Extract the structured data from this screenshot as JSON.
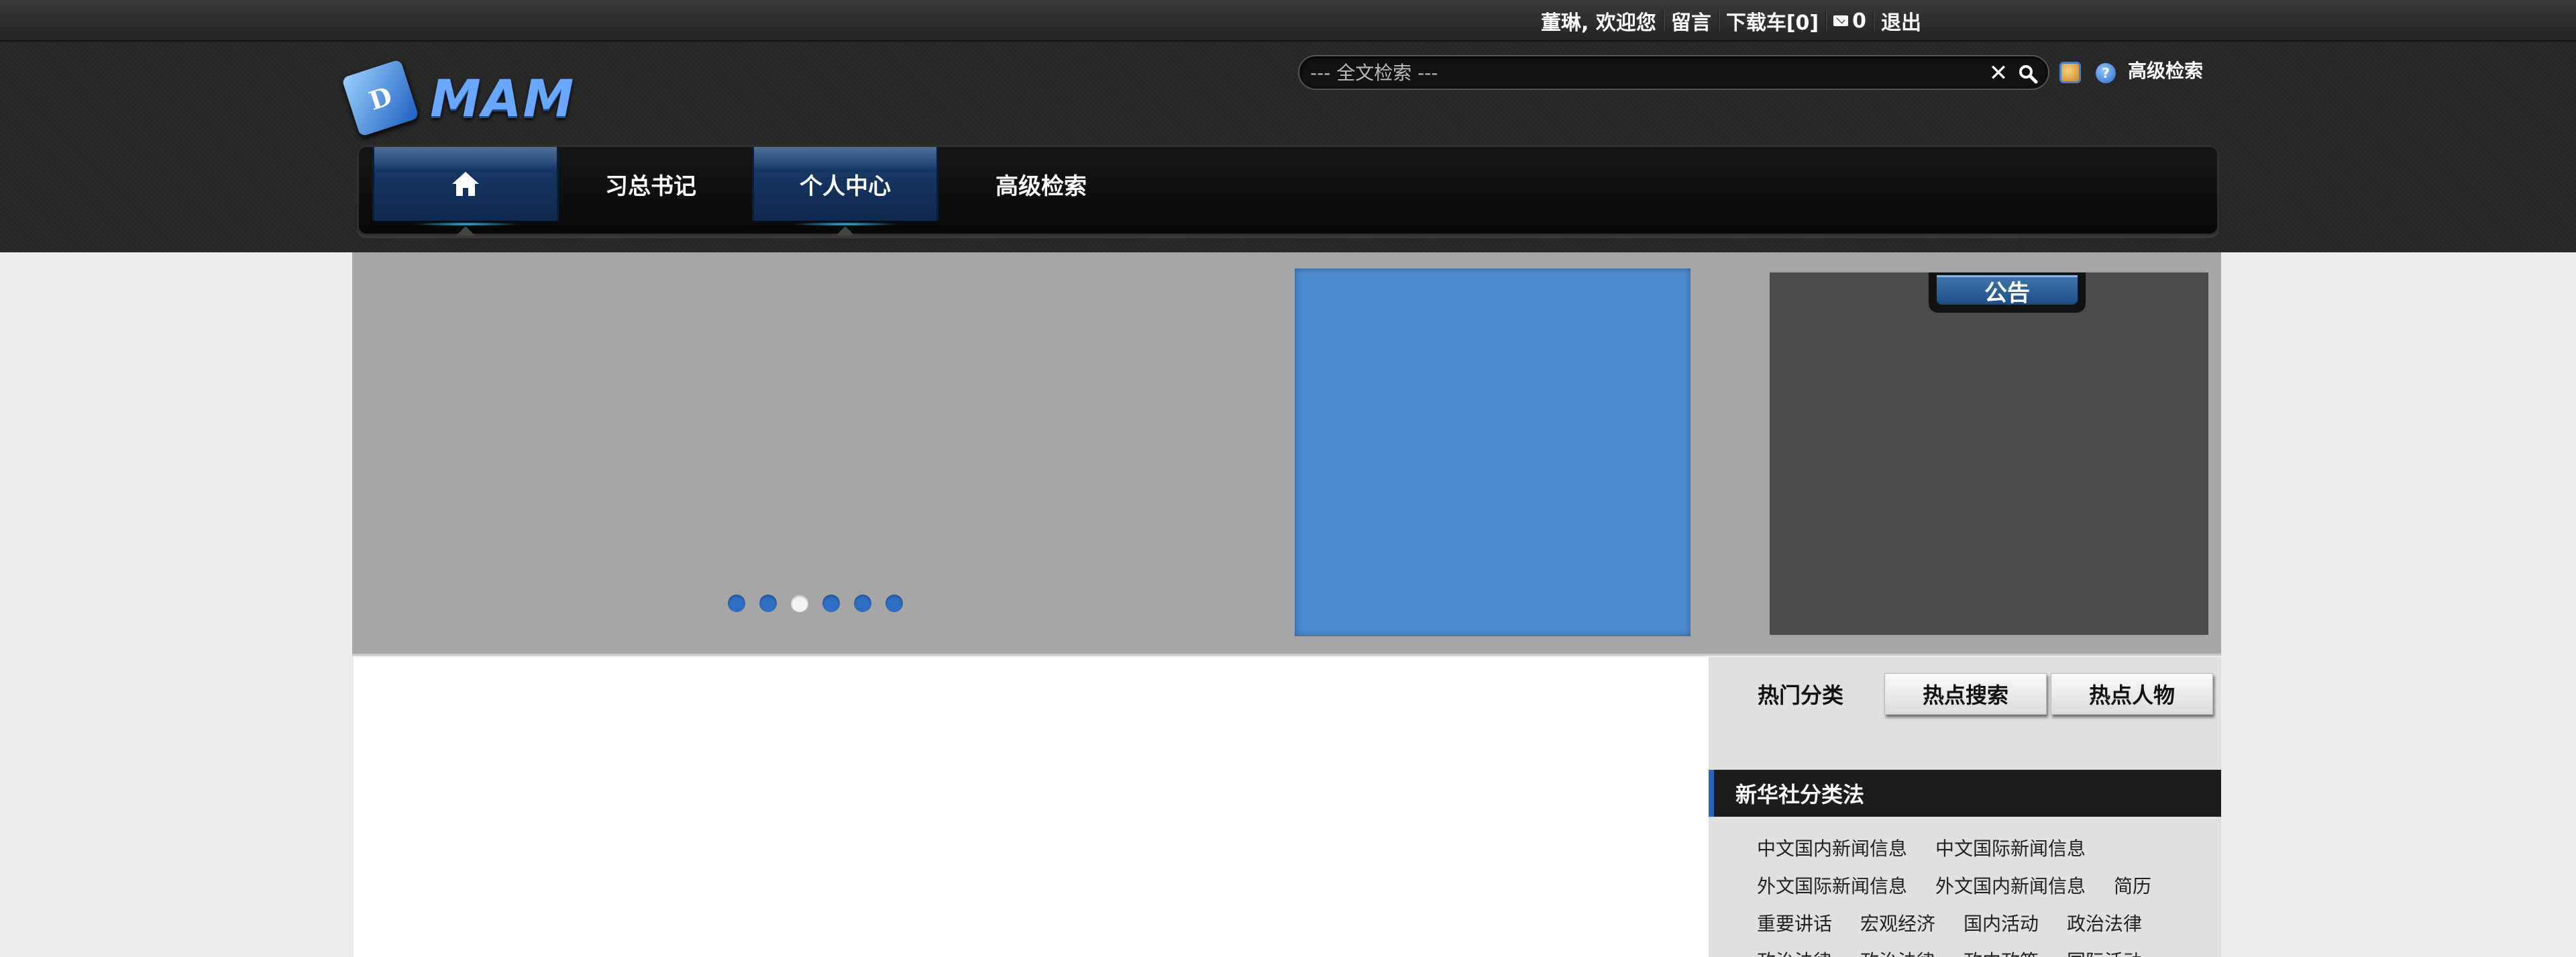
{
  "topbar": {
    "welcome": "董琳, 欢迎您",
    "message": "留言",
    "cart": "下载车[0]",
    "mail_count": "0",
    "logout": "退出"
  },
  "logo": {
    "mark": "D",
    "text": "MAM"
  },
  "search": {
    "placeholder": "--- 全文检索 ---",
    "clear_symbol": "✕",
    "advanced_label": "高级检索"
  },
  "nav": {
    "items": [
      {
        "label": "",
        "icon": "home-icon",
        "active": true
      },
      {
        "label": "习总书记",
        "active": false
      },
      {
        "label": "个人中心",
        "active": true
      },
      {
        "label": "高级检索",
        "active": false
      }
    ]
  },
  "banner": {
    "slide_count": 6,
    "active_slide": 3,
    "notice_title": "公告",
    "colors": {
      "feature": "#4c8bd0",
      "dot": "#2f6ec2"
    }
  },
  "sidebar": {
    "tabs": [
      "热门分类",
      "热点搜索",
      "热点人物"
    ],
    "section_title": "新华社分类法",
    "categories": [
      "中文国内新闻信息",
      "中文国际新闻信息",
      "外文国际新闻信息",
      "外文国内新闻信息",
      "简历",
      "重要讲话",
      "宏观经济",
      "国内活动",
      "政治法律",
      "政治法律",
      "政治法律",
      "政内政策",
      "国际活动"
    ]
  }
}
